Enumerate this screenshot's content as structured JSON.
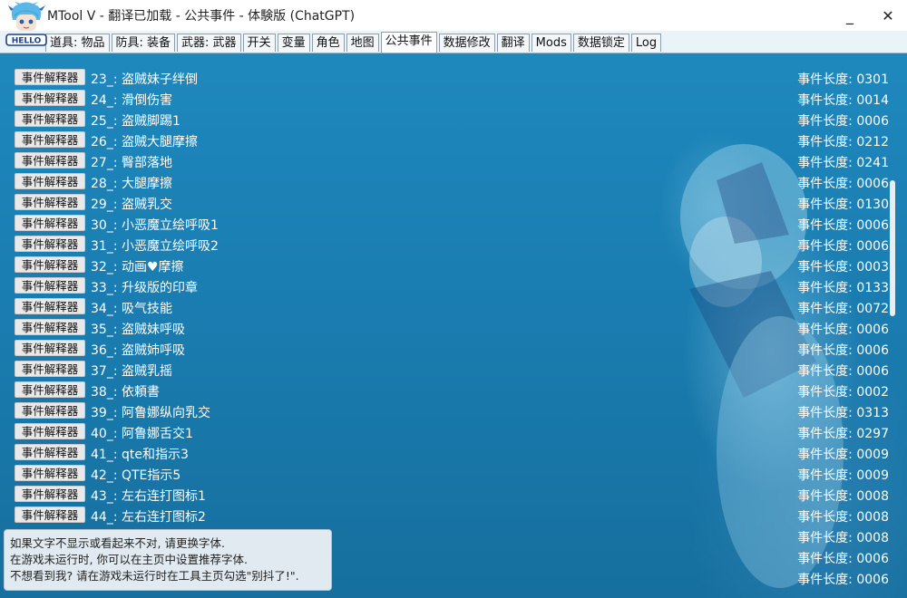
{
  "window": {
    "title": "MTool V - 翻译已加载 - 公共事件 - 体験版 (ChatGPT)",
    "minimize_glyph": "_",
    "close_glyph": "✕",
    "icon_text": "HELLO",
    "icon_name": "app-mascot-icon"
  },
  "tabs": [
    {
      "label": "道具: 物品",
      "active": false
    },
    {
      "label": "防具: 装备",
      "active": false
    },
    {
      "label": "武器: 武器",
      "active": false
    },
    {
      "label": "开关",
      "active": false
    },
    {
      "label": "变量",
      "active": false
    },
    {
      "label": "角色",
      "active": false
    },
    {
      "label": "地图",
      "active": false
    },
    {
      "label": "公共事件",
      "active": true
    },
    {
      "label": "数据修改",
      "active": false
    },
    {
      "label": "翻译",
      "active": false
    },
    {
      "label": "Mods",
      "active": false
    },
    {
      "label": "数据锁定",
      "active": false
    },
    {
      "label": "Log",
      "active": false
    }
  ],
  "events": {
    "button_label": "事件解释器",
    "length_prefix": "事件长度: ",
    "rows": [
      {
        "label": "23_: 盗贼妹子绊倒",
        "length": "0301"
      },
      {
        "label": "24_: 滑倒伤害",
        "length": "0014"
      },
      {
        "label": "25_: 盗贼脚踢1",
        "length": "0006"
      },
      {
        "label": "26_: 盗贼大腿摩擦",
        "length": "0212"
      },
      {
        "label": "27_: 臀部落地",
        "length": "0241"
      },
      {
        "label": "28_: 大腿摩擦",
        "length": "0006"
      },
      {
        "label": "29_: 盗贼乳交",
        "length": "0130"
      },
      {
        "label": "30_: 小恶魔立绘呼吸1",
        "length": "0006"
      },
      {
        "label": "31_: 小恶魔立绘呼吸2",
        "length": "0006"
      },
      {
        "label": "32_: 动画♥摩擦",
        "length": "0003"
      },
      {
        "label": "33_: 升级版的印章",
        "length": "0133"
      },
      {
        "label": "34_: 吸气技能",
        "length": "0072"
      },
      {
        "label": "35_: 盗贼妹呼吸",
        "length": "0006"
      },
      {
        "label": "36_: 盗贼姉呼吸",
        "length": "0006"
      },
      {
        "label": "37_: 盗贼乳摇",
        "length": "0006"
      },
      {
        "label": "38_: 依頼書",
        "length": "0002"
      },
      {
        "label": "39_: 阿鲁娜纵向乳交",
        "length": "0313"
      },
      {
        "label": "40_: 阿鲁娜舌交1",
        "length": "0297"
      },
      {
        "label": "41_: qte和指示3",
        "length": "0009"
      },
      {
        "label": "42_: QTE指示5",
        "length": "0009"
      },
      {
        "label": "43_: 左右连打图标1",
        "length": "0008"
      },
      {
        "label": "44_: 左右连打图标2",
        "length": "0008"
      },
      {
        "label": "",
        "length": "0008"
      },
      {
        "label": "",
        "length": "0006"
      },
      {
        "label": "",
        "length": "0006"
      }
    ]
  },
  "notice": {
    "line1": "如果文字不显示或看起来不对, 请更换字体.",
    "line2": "在游戏未运行时, 你可以在主页中设置推荐字体.",
    "line3": "不想看到我? 请在游戏未运行时在工具主页勾选\"别抖了!\"."
  },
  "colors": {
    "content_bg": "#1a7ab0",
    "row_text": "#ffffff",
    "button_bg": "#e9e9e9"
  }
}
